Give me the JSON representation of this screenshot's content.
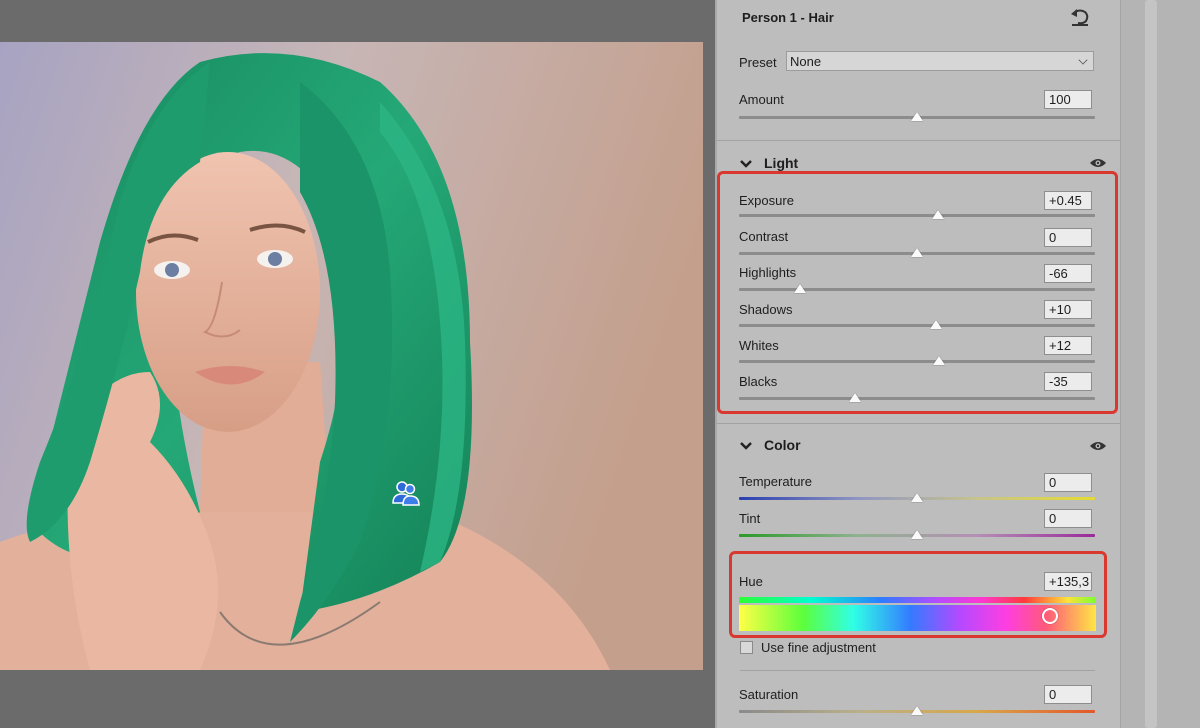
{
  "panel": {
    "title": "Person 1 - Hair",
    "preset_label": "Preset",
    "preset_value": "None",
    "amount_label": "Amount",
    "amount_value": "100"
  },
  "light": {
    "title": "Light",
    "sliders": [
      {
        "label": "Exposure",
        "value": "+0.45"
      },
      {
        "label": "Contrast",
        "value": "0"
      },
      {
        "label": "Highlights",
        "value": "-66"
      },
      {
        "label": "Shadows",
        "value": "+10"
      },
      {
        "label": "Whites",
        "value": "+12"
      },
      {
        "label": "Blacks",
        "value": "-35"
      }
    ]
  },
  "color": {
    "title": "Color",
    "temperature_label": "Temperature",
    "temperature_value": "0",
    "tint_label": "Tint",
    "tint_value": "0",
    "hue_label": "Hue",
    "hue_value": "+135,3",
    "fine_adjustment_label": "Use fine adjustment",
    "saturation_label": "Saturation",
    "saturation_value": "0"
  },
  "colors": {
    "panel_bg": "#bdbdbd",
    "highlight_box": "#d9382f",
    "hair": "#1f9c6e"
  },
  "icons": [
    "reset-icon",
    "chevron-down-icon",
    "eye-icon",
    "person-mask-icon"
  ]
}
